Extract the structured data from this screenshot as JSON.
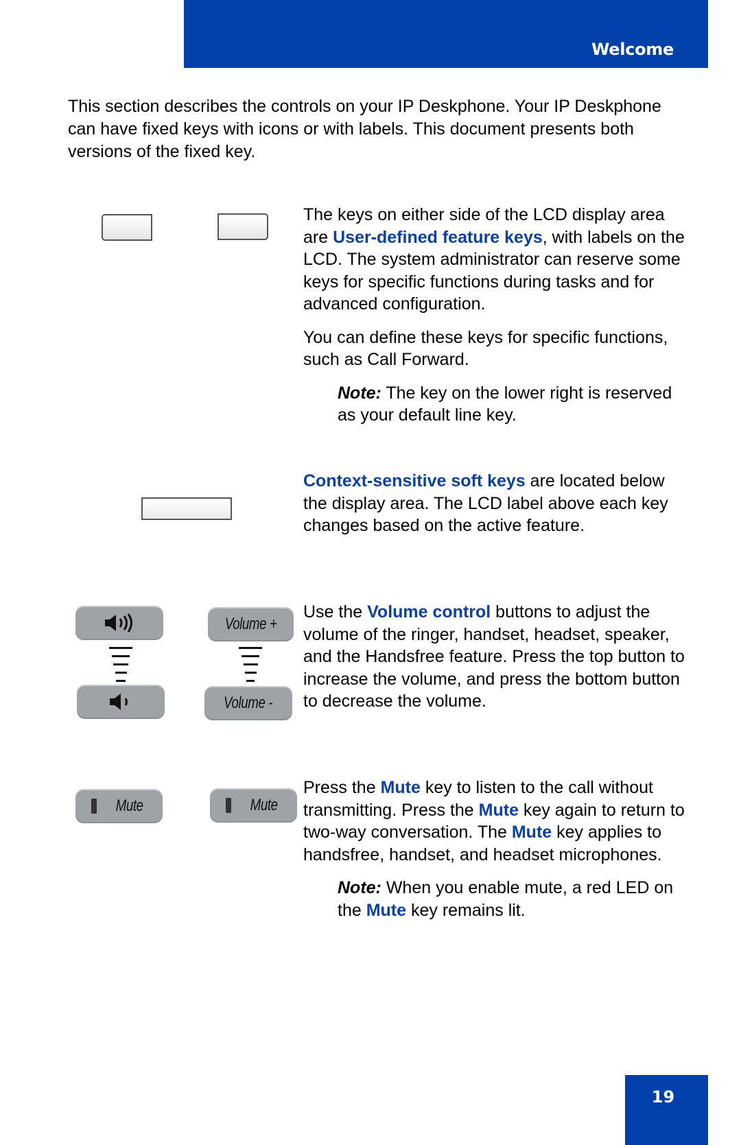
{
  "header": {
    "title": "Welcome"
  },
  "intro": "This section describes the controls on your IP Deskphone. Your IP Deskphone can have fixed keys with icons or with labels. This document presents both versions of the fixed key.",
  "feature_keys": {
    "p1_before": "The keys on either side of the LCD display area are ",
    "p1_link": "User-defined feature keys",
    "p1_after": ", with labels on the LCD. The system administrator can reserve some keys for specific functions during tasks and for advanced configuration.",
    "p2": "You can define these keys for specific functions, such as Call Forward.",
    "note_label": "Note:",
    "note_text": " The key on the lower right is reserved as your default line key."
  },
  "soft_keys": {
    "link": "Context-sensitive soft keys",
    "after": " are located below the display area. The LCD label above each key changes based on the active feature."
  },
  "volume": {
    "before": "Use the ",
    "link": "Volume control",
    "after": " buttons to adjust the volume of the ringer, handset, headset, speaker, and the Handsfree feature. Press the top button to increase the volume, and press the bottom button to decrease the volume.",
    "up_label": "Volume +",
    "down_label": "Volume -"
  },
  "mute": {
    "t1": "Press the ",
    "k1": "Mute",
    "t2": " key to listen to the call without transmitting. Press the ",
    "k2": "Mute",
    "t3": " key again to return to two-way conversation. The ",
    "k3": "Mute",
    "t4": " key applies to handsfree, handset, and headset microphones.",
    "button_label": "Mute",
    "note_label": "Note:",
    "note_t1": " When you enable mute, a red LED on the ",
    "note_k": "Mute",
    "note_t2": " key remains lit."
  },
  "page_number": "19",
  "colors": {
    "brand_blue": "#0240ac",
    "link_blue": "#0a40a8",
    "button_gray": "#9ea3a8"
  }
}
